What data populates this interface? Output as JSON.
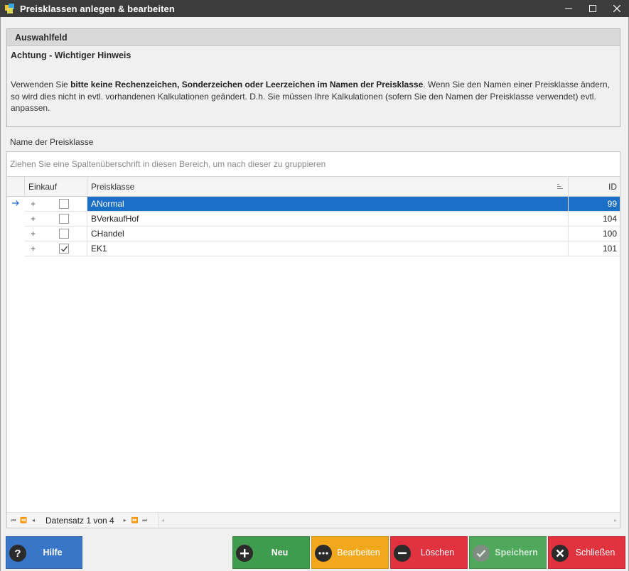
{
  "window": {
    "title": "Preisklassen anlegen & bearbeiten",
    "minimize": "–",
    "maximize": "☐",
    "close": "✕"
  },
  "panel": {
    "header": "Auswahlfeld",
    "subtitle": "Achtung  - Wichtiger Hinweis",
    "text_pre": "Verwenden Sie ",
    "text_bold": "bitte keine Rechenzeichen, Sonderzeichen oder Leerzeichen im Namen der Preisklasse",
    "text_post": ". Wenn Sie den Namen einer Preisklasse ändern, so wird dies nicht in evtl. vorhandenen Kalkulationen geändert. D.h. Sie müssen Ihre Kalkulationen (sofern Sie den Namen der Preisklasse verwendet) evtl. anpassen."
  },
  "field_label": "Name der Preisklasse",
  "grid": {
    "group_hint": "Ziehen Sie eine Spaltenüberschrift in diesen Bereich, um nach dieser zu gruppieren",
    "columns": {
      "einkauf": "Einkauf",
      "preisklasse": "Preisklasse",
      "id": "ID"
    },
    "rows": [
      {
        "expander": "+",
        "einkauf": false,
        "preisklasse": "ANormal",
        "id": "99",
        "selected": true
      },
      {
        "expander": "+",
        "einkauf": false,
        "preisklasse": "BVerkaufHof",
        "id": "104",
        "selected": false
      },
      {
        "expander": "+",
        "einkauf": false,
        "preisklasse": "CHandel",
        "id": "100",
        "selected": false
      },
      {
        "expander": "+",
        "einkauf": true,
        "preisklasse": "EK1",
        "id": "101",
        "selected": false
      }
    ],
    "navigator": "Datensatz 1 von 4"
  },
  "buttons": {
    "hilfe": "Hilfe",
    "neu": "Neu",
    "bearbeiten": "Bearbeiten",
    "loeschen": "Löschen",
    "speichern": "Speichern",
    "schliessen": "Schließen"
  },
  "colors": {
    "hilfe": "#3a76c8",
    "neu": "#3f9c4e",
    "bearbeiten": "#f2a81d",
    "loeschen": "#e0323f",
    "speichern": "#4fa85b",
    "schliessen": "#e0323f",
    "selection": "#1c6fc6"
  }
}
